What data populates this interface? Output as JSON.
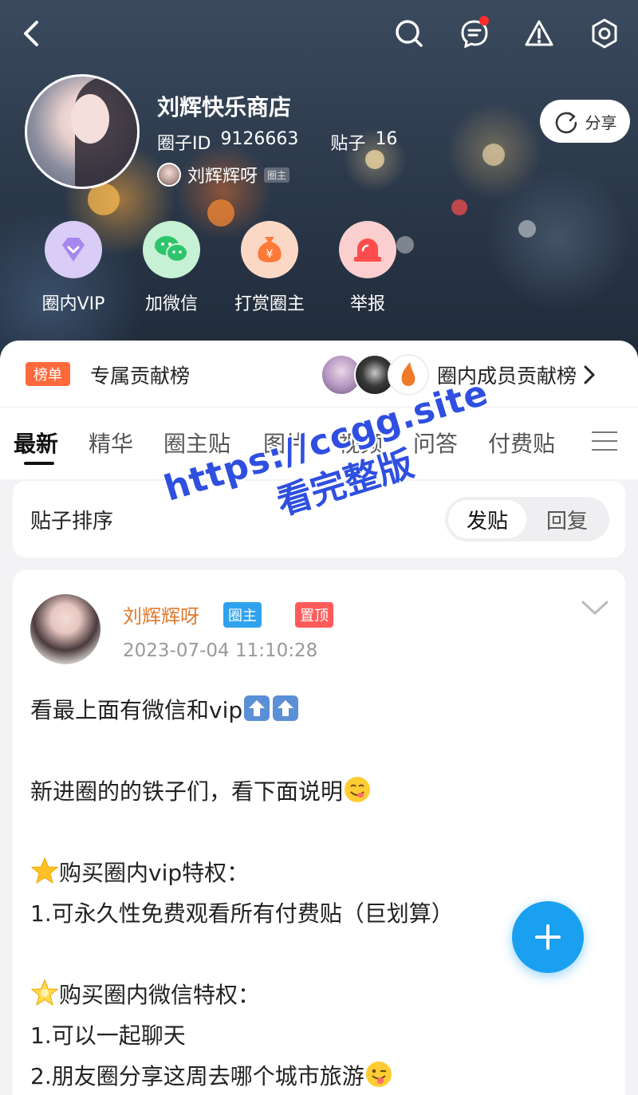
{
  "header": {
    "circle_name": "刘辉快乐商店",
    "circle_id_label": "圈子ID",
    "circle_id": "9126663",
    "posts_label": "贴子",
    "posts_count": "16",
    "owner_name": "刘辉辉呀",
    "owner_tag": "圈主",
    "share_label": "分享"
  },
  "actions": [
    {
      "label": "圈内VIP",
      "icon": "diamond-icon",
      "color": "#d9cdf7"
    },
    {
      "label": "加微信",
      "icon": "wechat-icon",
      "color": "#c6f1d4"
    },
    {
      "label": "打赏圈主",
      "icon": "money-bag-icon",
      "color": "#fbd8c6"
    },
    {
      "label": "举报",
      "icon": "alarm-icon",
      "color": "#fbcfcf"
    }
  ],
  "rank": {
    "tag": "榜单",
    "title": "专属贡献榜",
    "right_label": "圈内成员贡献榜"
  },
  "tabs": [
    "最新",
    "精华",
    "圈主贴",
    "图片",
    "视频",
    "问答",
    "付费贴"
  ],
  "sort": {
    "label": "贴子排序",
    "options": [
      "发贴",
      "回复"
    ],
    "selected": "发贴"
  },
  "post": {
    "author": "刘辉辉呀",
    "badge_owner": "圈主",
    "badge_pinned": "置顶",
    "time": "2023-07-04 11:10:28",
    "lines": [
      "看最上面有微信和vip",
      "",
      "新进圈的的铁子们，看下面说明",
      "",
      "购买圈内vip特权：",
      "1.可永久性免费观看所有付费贴（巨划算）",
      "",
      "购买圈内微信特权：",
      "1.可以一起聊天",
      "2.朋友圈分享这周去哪个城市旅游"
    ]
  },
  "watermark": {
    "line1": "https://ccgg.site",
    "line2": "看完整版"
  },
  "colors": {
    "accent": "#1aa0f0",
    "author": "#e07a2e",
    "rank_tag": "#ff6a3d",
    "pinned": "#ff5b5b",
    "owner_badge": "#2fa2ee"
  }
}
